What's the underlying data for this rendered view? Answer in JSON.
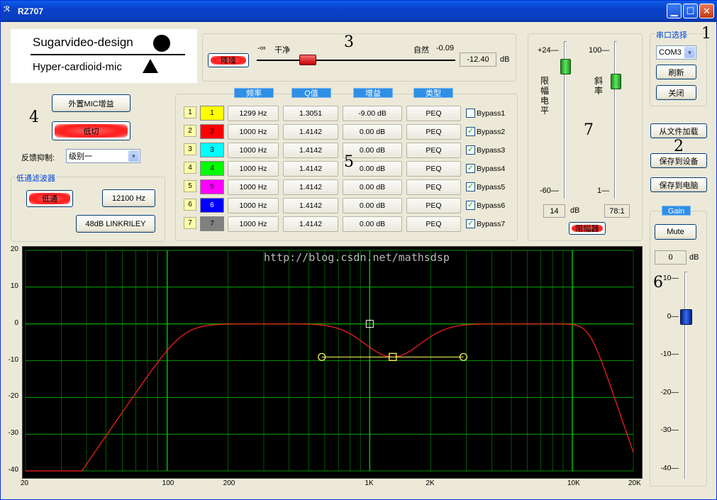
{
  "window": {
    "title": "RZ707",
    "icon_name": "app-icon"
  },
  "logo": {
    "line1": "Sugarvideo-design",
    "line2": "Hyper-cardioid-mic"
  },
  "section_numbers": {
    "n1": "1",
    "n2": "2",
    "n3": "3",
    "n4": "4",
    "n5": "5",
    "n6": "6",
    "n7": "7"
  },
  "denoise": {
    "button": "降噪",
    "left_label": "-∞",
    "clean": "干净",
    "natural": "自然",
    "natural_val": "-0.09",
    "value": "-12.40",
    "unit": "dB"
  },
  "serial": {
    "title": "串口选择",
    "port": "COM3",
    "refresh": "刷新",
    "close": "关闭"
  },
  "file": {
    "load": "从文件加载",
    "save_device": "保存到设备",
    "save_pc": "保存到电脑"
  },
  "left": {
    "ext_mic": "外置MIC增益",
    "lowcut": "低切",
    "feedback_label": "反馈抑制:",
    "feedback_level": "级别一",
    "lpf_title": "低通滤波器",
    "lpf_button": "低通",
    "lpf_freq": "12100 Hz",
    "lpf_type": "48dB LINKRILEY"
  },
  "peq": {
    "headers": [
      "频率",
      "Q值",
      "增益",
      "类型"
    ],
    "rows": [
      {
        "idx": "1",
        "label": "1",
        "color": "#ffff00",
        "freq": "1299 Hz",
        "q": "1.3051",
        "gain": "-9.00 dB",
        "type": "PEQ",
        "bypass": "Bypass1",
        "checked": false
      },
      {
        "idx": "2",
        "label": "2",
        "color": "#ff0000",
        "freq": "1000 Hz",
        "q": "1.4142",
        "gain": "0.00 dB",
        "type": "PEQ",
        "bypass": "Bypass2",
        "checked": true
      },
      {
        "idx": "3",
        "label": "3",
        "color": "#00ffff",
        "freq": "1000 Hz",
        "q": "1.4142",
        "gain": "0.00 dB",
        "type": "PEQ",
        "bypass": "Bypass3",
        "checked": true
      },
      {
        "idx": "4",
        "label": "4",
        "color": "#00ff00",
        "freq": "1000 Hz",
        "q": "1.4142",
        "gain": "0.00 dB",
        "type": "PEQ",
        "bypass": "Bypass4",
        "checked": true
      },
      {
        "idx": "5",
        "label": "5",
        "color": "#ff00ff",
        "freq": "1000 Hz",
        "q": "1.4142",
        "gain": "0.00 dB",
        "type": "PEQ",
        "bypass": "Bypass5",
        "checked": true
      },
      {
        "idx": "6",
        "label": "6",
        "color": "#0000ff",
        "freq": "1000 Hz",
        "q": "1.4142",
        "gain": "0.00 dB",
        "type": "PEQ",
        "bypass": "Bypass6",
        "checked": true
      },
      {
        "idx": "7",
        "label": "7",
        "color": "#808080",
        "freq": "1000 Hz",
        "q": "1.4142",
        "gain": "0.00 dB",
        "type": "PEQ",
        "bypass": "Bypass7",
        "checked": true
      }
    ]
  },
  "limiter": {
    "level_label": "限幅电平",
    "ratio_label": "斜率",
    "level_top": "+24—",
    "level_bottom": "-60—",
    "ratio_top": "100—",
    "ratio_bottom": "1—",
    "level_value": "14",
    "level_unit": "dB",
    "ratio_value": "78:1",
    "button": "限幅器",
    "level_db": 14,
    "ratio": 78
  },
  "gain": {
    "title": "Gain",
    "mute": "Mute",
    "value": "0",
    "unit": "dB",
    "ticks": [
      "10—",
      "0—",
      "-10—",
      "-20—",
      "-30—",
      "-40—"
    ],
    "level_db": 0
  },
  "graph": {
    "watermark": "http://blog.csdn.net/mathsdsp",
    "y_ticks": [
      "20",
      "10",
      "0",
      "-10",
      "-20",
      "-30",
      "-40"
    ],
    "x_ticks": [
      "20",
      "100",
      "200",
      "1K",
      "2K",
      "10K",
      "20K"
    ],
    "grid_color": "#00c000",
    "curve_color": "#ff2020"
  }
}
